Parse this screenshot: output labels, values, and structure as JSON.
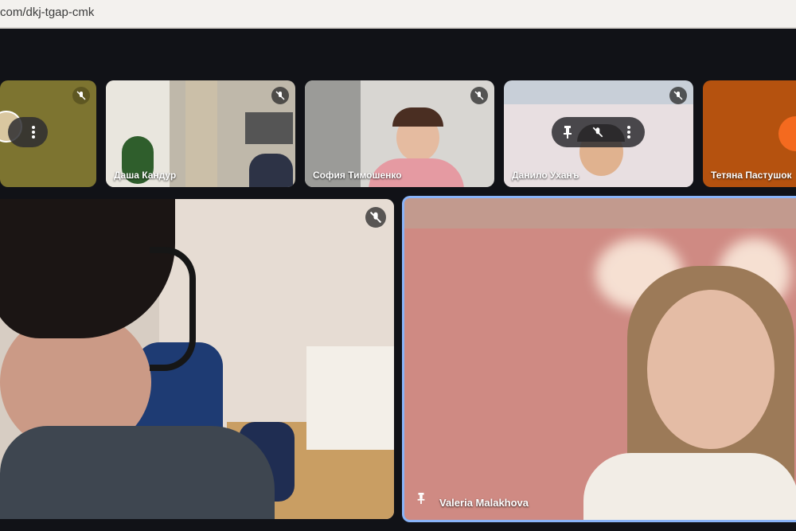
{
  "browser": {
    "url": "com/dkj-tgap-cmk"
  },
  "participants": [
    {
      "name": ""
    },
    {
      "name": "Даша Кандур"
    },
    {
      "name": "София Тимошенко"
    },
    {
      "name": "Данило Уханъ"
    },
    {
      "name": "Тетяна Пастушок"
    }
  ],
  "main": {
    "left_tile": {
      "name": ""
    },
    "right_tile": {
      "name": "Valeria Malakhova"
    }
  },
  "colors": {
    "accent": "#8ab4f8",
    "avatar_orange": "#f46a1f",
    "mic_bg": "#3a3a3a"
  }
}
